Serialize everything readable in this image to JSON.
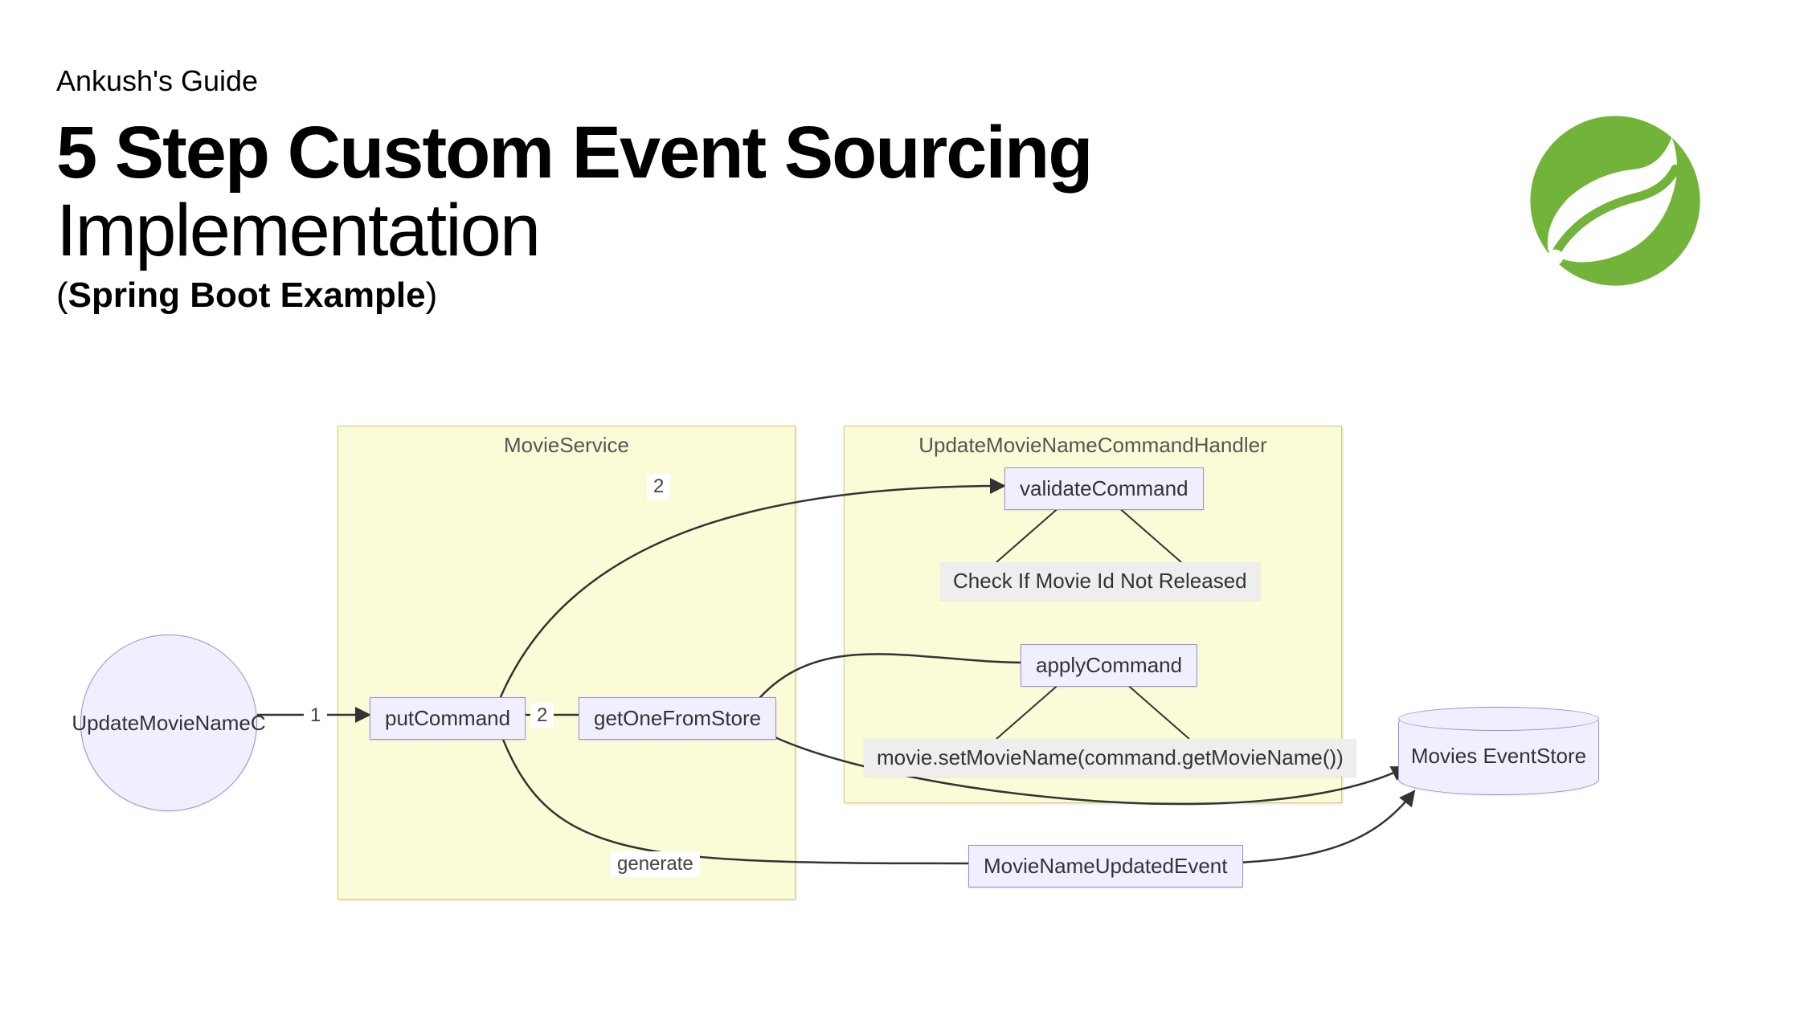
{
  "header": {
    "guide_label": "Ankush's Guide",
    "title_bold": "5 Step Custom Event Sourcing",
    "title_light": "Implementation",
    "subtitle_open": "(",
    "subtitle_bold": "Spring Boot Example",
    "subtitle_close": ")"
  },
  "colors": {
    "spring_green": "#72b33a",
    "node_fill": "#f0efff",
    "node_border": "#9a8ed8",
    "group_fill": "#fbfbd8",
    "group_border": "#d0d070"
  },
  "diagram": {
    "groups": {
      "movie_service": "MovieService",
      "handler": "UpdateMovieNameCommandHandler"
    },
    "nodes": {
      "start_circle": "UpdateMovieNameC",
      "put_command": "putCommand",
      "get_one": "getOneFromStore",
      "validate": "validateCommand",
      "check_text": "Check If Movie Id Not Released",
      "apply": "applyCommand",
      "set_name": "movie.setMovieName(command.getMovieName())",
      "event": "MovieNameUpdatedEvent",
      "store": "Movies EventStore"
    },
    "edges": {
      "e1": "1",
      "e2a": "2",
      "e2b": "2",
      "generate": "generate"
    }
  }
}
